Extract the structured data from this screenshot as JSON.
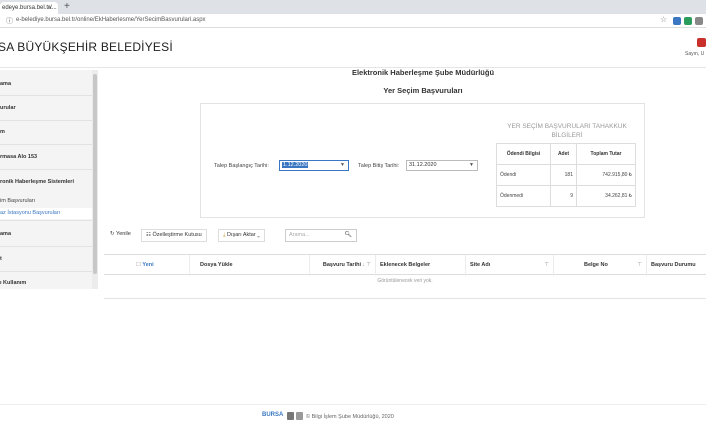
{
  "browser": {
    "tab_title": "edeye.bursa.bel.tr/...",
    "tab_close": "×",
    "new_tab": "+",
    "url": "e-belediye.bursa.bel.tr/online/EkHaberlesme/YerSecimBasvurulari.aspx"
  },
  "header": {
    "title": "SA BÜYÜKŞEHİR BELEDİYESİ",
    "user_name": "Sayın, U"
  },
  "sidebar": {
    "items": [
      {
        "label": "ama"
      },
      {
        "label": "urular"
      },
      {
        "label": "m"
      },
      {
        "label": "rmasa Alo 153"
      },
      {
        "label": "ronik Haberleşme Sistemleri"
      },
      {
        "label": "im Başvuruları",
        "sub": true
      },
      {
        "label": "az İstasyonu Başvuruları",
        "sub": true,
        "active": true
      },
      {
        "label": "ama"
      },
      {
        "label": "t"
      },
      {
        "label": "ı Kullanım"
      }
    ]
  },
  "main": {
    "title": "Elektronik Haberleşme Şube Müdürlüğü",
    "subtitle": "Yer Seçim Başvuruları"
  },
  "filters": {
    "start_label": "Talep Başlangıç Tarihi:",
    "start_value": "1.12.2020",
    "end_label": "Talep Bitiş Tarihi:",
    "end_value": "31.12.2020"
  },
  "tahakkuk": {
    "title": "YER SEÇİM BAŞVURULARI TAHAKKUK BİLGİLERİ",
    "headers": [
      "Ödendi Bilgisi",
      "Adet",
      "Toplam Tutar"
    ],
    "rows": [
      [
        "Ödendi",
        "181",
        "742.915,80 ₺"
      ],
      [
        "Ödenmedi",
        "9",
        "34.262,81 ₺"
      ]
    ]
  },
  "toolbar": {
    "refresh": "Yenile",
    "customize": "Özelleştirme Kutusu",
    "export": "Dışarı Aktar",
    "search_placeholder": "Arama..."
  },
  "grid": {
    "columns": [
      "Yeni",
      "Dosya Yükle",
      "Başvuru Tarihi",
      "Eklenecek Belgeler",
      "Site Adı",
      "Belge No",
      "Başvuru Durumu"
    ],
    "empty": "Görüntülenecek veri yok."
  },
  "footer": {
    "logo": "BURSA",
    "text": "© Bilgi İşlem Şube Müdürlüğü, 2020"
  },
  "colors": {
    "accent": "#3a77c3",
    "user_badge": "#c9302c"
  }
}
